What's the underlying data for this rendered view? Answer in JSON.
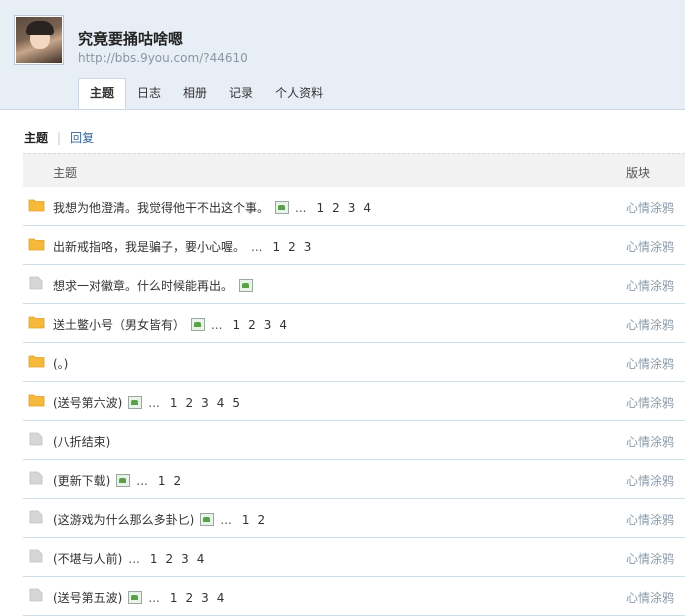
{
  "header": {
    "space_name": "究竟要捅咕啥嗯",
    "url": "http://bbs.9you.com/?44610"
  },
  "tabs": [
    {
      "label": "主题",
      "active": true
    },
    {
      "label": "日志",
      "active": false
    },
    {
      "label": "相册",
      "active": false
    },
    {
      "label": "记录",
      "active": false
    },
    {
      "label": "个人资料",
      "active": false
    }
  ],
  "subnav": {
    "current": "主题",
    "separator": "|",
    "link": "回复"
  },
  "table": {
    "col_title": "主题",
    "col_forum": "版块"
  },
  "threads": [
    {
      "title": "我想为他澄清。我觉得他干不出这个事。",
      "icon": "folder-orange",
      "has_image": true,
      "pages": [
        "1",
        "2",
        "3",
        "4"
      ],
      "forum": "心情涂鸦"
    },
    {
      "title": "出新戒指咯，我是骗子，要小心喔。",
      "icon": "folder-orange",
      "has_image": false,
      "pages": [
        "1",
        "2",
        "3"
      ],
      "forum": "心情涂鸦"
    },
    {
      "title": "想求一对徽章。什么时候能再出。",
      "icon": "folder-gray",
      "has_image": true,
      "pages": [],
      "forum": "心情涂鸦"
    },
    {
      "title": "送土鳖小号（男女皆有）",
      "icon": "folder-orange",
      "has_image": true,
      "pages": [
        "1",
        "2",
        "3",
        "4"
      ],
      "forum": "心情涂鸦"
    },
    {
      "title": "(。)",
      "icon": "folder-orange",
      "has_image": false,
      "pages": [],
      "forum": "心情涂鸦"
    },
    {
      "title": "(送号第六波)",
      "icon": "folder-orange",
      "has_image": true,
      "pages": [
        "1",
        "2",
        "3",
        "4",
        "5"
      ],
      "forum": "心情涂鸦"
    },
    {
      "title": "(八折结束)",
      "icon": "folder-gray",
      "has_image": false,
      "pages": [],
      "forum": "心情涂鸦"
    },
    {
      "title": "(更新下载)",
      "icon": "folder-gray",
      "has_image": true,
      "pages": [
        "1",
        "2"
      ],
      "forum": "心情涂鸦"
    },
    {
      "title": "(这游戏为什么那么多卦匕)",
      "icon": "folder-gray",
      "has_image": true,
      "pages": [
        "1",
        "2"
      ],
      "forum": "心情涂鸦"
    },
    {
      "title": "(不堪与人前)",
      "icon": "folder-gray",
      "has_image": false,
      "pages": [
        "1",
        "2",
        "3",
        "4"
      ],
      "forum": "心情涂鸦"
    },
    {
      "title": "(送号第五波)",
      "icon": "folder-gray",
      "has_image": true,
      "pages": [
        "1",
        "2",
        "3",
        "4"
      ],
      "forum": "心情涂鸦"
    }
  ],
  "ellipsis": "...",
  "colors": {
    "header_bg": "#e8eef6",
    "folder_orange": "#f6b93b",
    "folder_gray": "#d6d6d6",
    "forum_text": "#8a9aa8",
    "link": "#336699"
  }
}
